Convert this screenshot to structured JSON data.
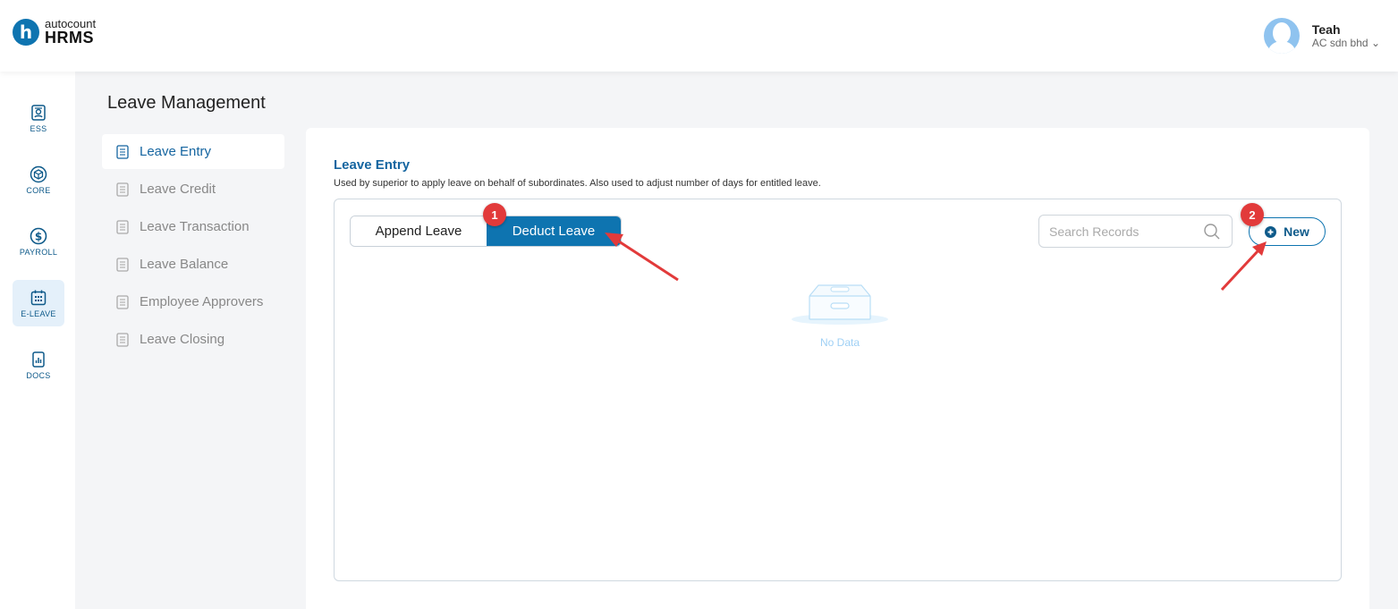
{
  "header": {
    "logo_top": "autocount",
    "logo_bottom": "HRMS",
    "user_name": "Teah",
    "user_company": "AC sdn bhd"
  },
  "rail": [
    {
      "label": "ESS",
      "icon": "id-card-icon"
    },
    {
      "label": "CORE",
      "icon": "cube-icon"
    },
    {
      "label": "PAYROLL",
      "icon": "dollar-coin-icon"
    },
    {
      "label": "E-LEAVE",
      "icon": "calendar-icon",
      "active": true
    },
    {
      "label": "DOCS",
      "icon": "document-chart-icon"
    }
  ],
  "page_title": "Leave Management",
  "subnav": [
    {
      "label": "Leave Entry",
      "active": true
    },
    {
      "label": "Leave Credit"
    },
    {
      "label": "Leave Transaction"
    },
    {
      "label": "Leave Balance"
    },
    {
      "label": "Employee Approvers"
    },
    {
      "label": "Leave Closing"
    }
  ],
  "section": {
    "title": "Leave Entry",
    "description": "Used by superior to apply leave on behalf of subordinates. Also used to adjust number of days for entitled leave."
  },
  "toolbar": {
    "append_label": "Append Leave",
    "deduct_label": "Deduct Leave",
    "search_placeholder": "Search Records",
    "new_label": "New"
  },
  "empty_state": "No Data",
  "annotations": [
    "1",
    "2"
  ],
  "colors": {
    "accent": "#0e74b0",
    "badge": "#e23a3a"
  }
}
